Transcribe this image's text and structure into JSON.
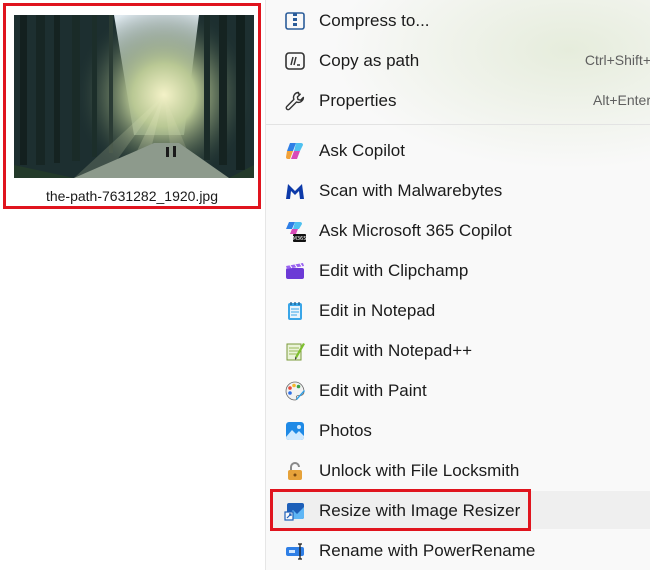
{
  "file": {
    "name": "the-path-7631282_1920.jpg"
  },
  "menu": {
    "top_items": [
      {
        "label": "Compress to...",
        "shortcut": "",
        "icon": "archive-folder-icon"
      },
      {
        "label": "Copy as path",
        "shortcut": "Ctrl+Shift+",
        "icon": "copy-path-icon"
      },
      {
        "label": "Properties",
        "shortcut": "Alt+Enter",
        "icon": "wrench-icon"
      }
    ],
    "app_items": [
      {
        "label": "Ask Copilot",
        "icon": "copilot-icon"
      },
      {
        "label": "Scan with Malwarebytes",
        "icon": "malwarebytes-icon"
      },
      {
        "label": "Ask Microsoft 365 Copilot",
        "icon": "m365-copilot-icon"
      },
      {
        "label": "Edit with Clipchamp",
        "icon": "clipchamp-icon"
      },
      {
        "label": "Edit in Notepad",
        "icon": "notepad-icon"
      },
      {
        "label": "Edit with Notepad++",
        "icon": "notepadpp-icon"
      },
      {
        "label": "Edit with Paint",
        "icon": "paint-palette-icon"
      },
      {
        "label": "Photos",
        "icon": "photos-icon"
      },
      {
        "label": "Unlock with File Locksmith",
        "icon": "padlock-icon"
      },
      {
        "label": "Resize with Image Resizer",
        "icon": "image-resizer-icon"
      },
      {
        "label": "Rename with PowerRename",
        "icon": "powerrename-icon"
      }
    ]
  },
  "colors": {
    "highlight_border": "#e0141e",
    "menu_background": "#f9f9f9"
  }
}
